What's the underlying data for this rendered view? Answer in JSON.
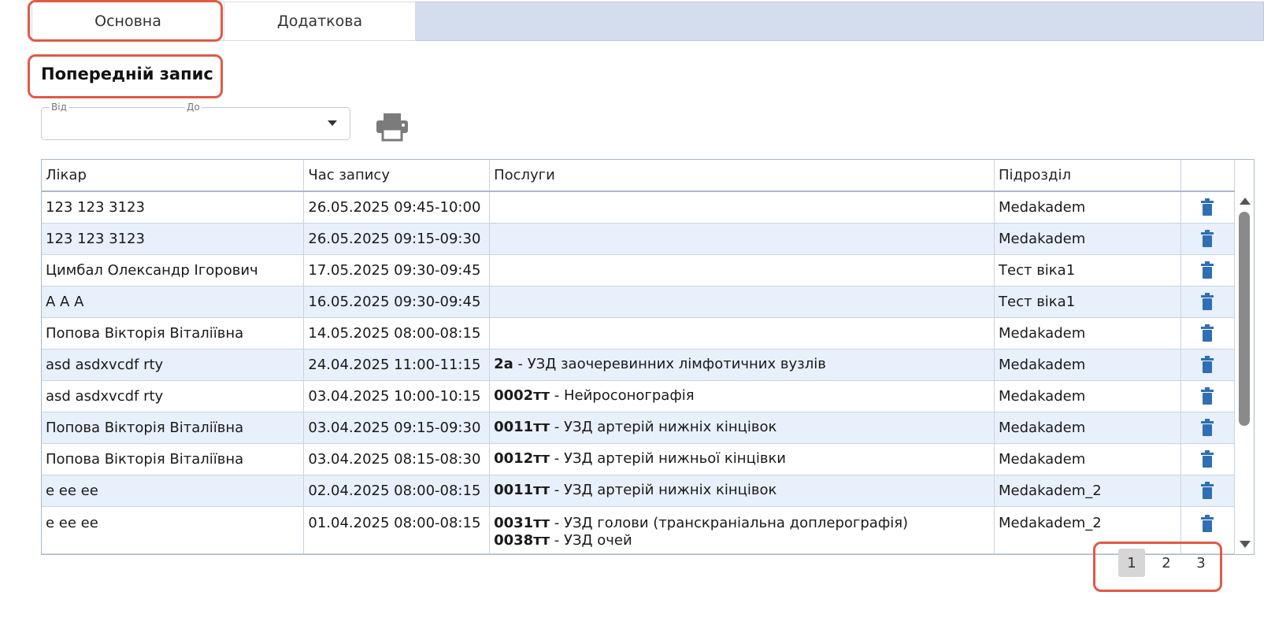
{
  "tabs": [
    {
      "label": "Основна",
      "active": true
    },
    {
      "label": "Додаткова",
      "active": false
    }
  ],
  "section_title": "Попередній запис",
  "date_filter": {
    "from_label": "Від",
    "to_label": "До"
  },
  "table": {
    "columns": [
      "Лікар",
      "Час запису",
      "Послуги",
      "Підрозділ",
      ""
    ],
    "rows": [
      {
        "doctor": "123 123 3123",
        "time": "26.05.2025 09:45-10:00",
        "services": [],
        "unit": "Medakadem"
      },
      {
        "doctor": "123 123 3123",
        "time": "26.05.2025 09:15-09:30",
        "services": [],
        "unit": "Medakadem"
      },
      {
        "doctor": "Цимбал Олександр Ігорович",
        "time": "17.05.2025 09:30-09:45",
        "services": [],
        "unit": "Тест віка1"
      },
      {
        "doctor": "А А А",
        "time": "16.05.2025 09:30-09:45",
        "services": [],
        "unit": "Тест віка1"
      },
      {
        "doctor": "Попова Вікторія Віталіївна",
        "time": "14.05.2025 08:00-08:15",
        "services": [],
        "unit": "Medakadem"
      },
      {
        "doctor": "asd asdxvcdf rty",
        "time": "24.04.2025 11:00-11:15",
        "services": [
          {
            "code": "2а",
            "name": " - УЗД заочеревинних лімфотичних вузлів"
          }
        ],
        "unit": "Medakadem"
      },
      {
        "doctor": "asd asdxvcdf rty",
        "time": "03.04.2025 10:00-10:15",
        "services": [
          {
            "code": "0002тт",
            "name": " - Нейросонографія"
          }
        ],
        "unit": "Medakadem"
      },
      {
        "doctor": "Попова Вікторія Віталіївна",
        "time": "03.04.2025 09:15-09:30",
        "services": [
          {
            "code": "0011тт",
            "name": " - УЗД артерій нижніх кінцівок"
          }
        ],
        "unit": "Medakadem"
      },
      {
        "doctor": "Попова Вікторія Віталіївна",
        "time": "03.04.2025 08:15-08:30",
        "services": [
          {
            "code": "0012тт",
            "name": " - УЗД артерій нижньої кінцівки"
          }
        ],
        "unit": "Medakadem"
      },
      {
        "doctor": "е ее ее",
        "time": "02.04.2025 08:00-08:15",
        "services": [
          {
            "code": "0011тт",
            "name": " - УЗД артерій нижніх кінцівок"
          }
        ],
        "unit": "Medakadem_2"
      },
      {
        "doctor": "е ее ее",
        "time": "01.04.2025 08:00-08:15",
        "services": [
          {
            "code": "0031тт",
            "name": " - УЗД голови (транскраніальна доплерографія)"
          },
          {
            "code": "0038тт",
            "name": " - УЗД очей"
          }
        ],
        "unit": "Medakadem_2"
      }
    ]
  },
  "pagination": {
    "pages": [
      "1",
      "2",
      "3"
    ],
    "current": "1"
  },
  "colors": {
    "highlight": "#e05a47",
    "alt_row": "#e8f0fb",
    "tab_filler": "#d3ddee",
    "trash_icon": "#2f6fb5"
  }
}
